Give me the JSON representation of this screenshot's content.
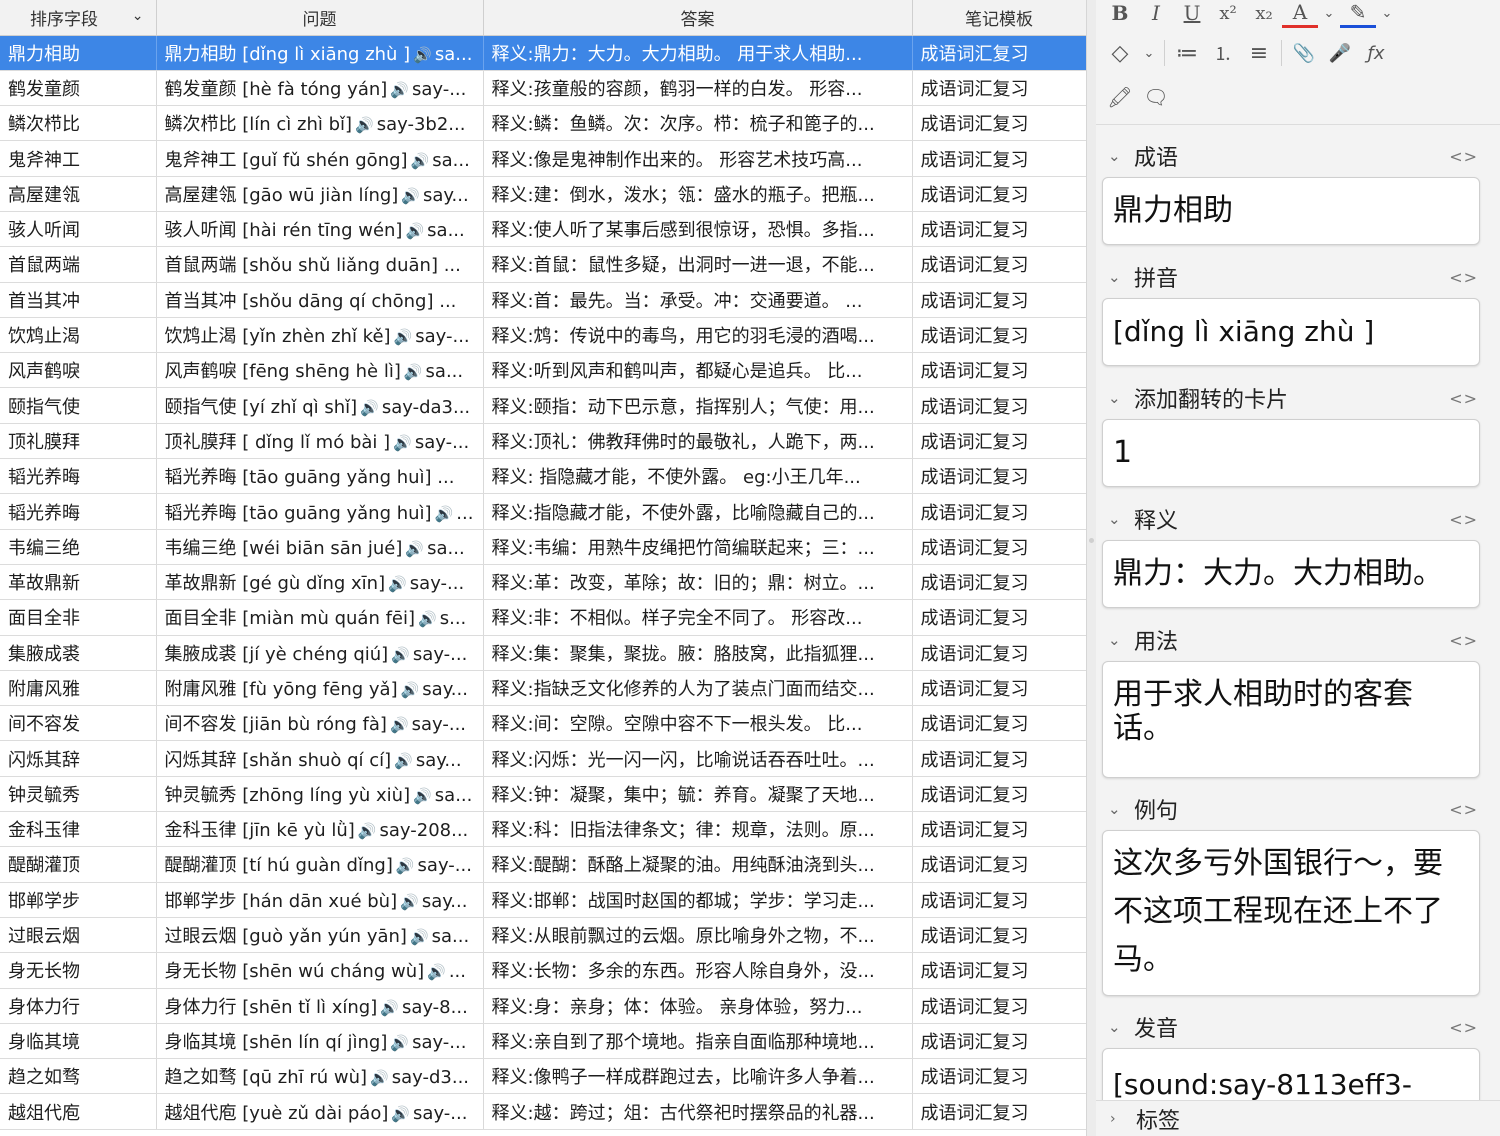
{
  "browser": {
    "columns": [
      "排序字段",
      "问题",
      "答案",
      "笔记模板"
    ],
    "selected_index": 0,
    "rows": [
      {
        "sort": "鼎力相助",
        "q": "鼎力相助 [dǐng lì xiāng zhù ]",
        "q_tail": "sa...",
        "a": "释义:鼎力：大力。大力相助。  用于求人相助...",
        "tpl": "成语词汇复习"
      },
      {
        "sort": "鹤发童颜",
        "q": "鹤发童颜 [hè fà tóng yán]",
        "q_tail": "say-...",
        "a": "释义:孩童般的容颜，鹤羽一样的白发。  形容...",
        "tpl": "成语词汇复习"
      },
      {
        "sort": "鳞次栉比",
        "q": "鳞次栉比 [lín cì zhì bǐ]",
        "q_tail": "say-3b2...",
        "a": "释义:鳞：鱼鳞。次：次序。栉：梳子和篦子的...",
        "tpl": "成语词汇复习"
      },
      {
        "sort": "鬼斧神工",
        "q": "鬼斧神工 [guǐ fǔ shén gōng]",
        "q_tail": "sa...",
        "a": "释义:像是鬼神制作出来的。  形容艺术技巧高...",
        "tpl": "成语词汇复习"
      },
      {
        "sort": "高屋建瓴",
        "q": "高屋建瓴 [gāo wū jiàn líng]",
        "q_tail": "say...",
        "a": "释义:建：倒水，泼水；瓴：盛水的瓶子。把瓶...",
        "tpl": "成语词汇复习"
      },
      {
        "sort": "骇人听闻",
        "q": "骇人听闻 [hài rén tīng wén]",
        "q_tail": "sa...",
        "a": "释义:使人听了某事后感到很惊讶，恐惧。多指...",
        "tpl": "成语词汇复习"
      },
      {
        "sort": "首鼠两端",
        "q": "首鼠两端 [shǒu shǔ liǎng duān] ...",
        "q_tail": "",
        "a": "释义:首鼠：鼠性多疑，出洞时一进一退，不能...",
        "tpl": "成语词汇复习"
      },
      {
        "sort": "首当其冲",
        "q": "首当其冲 [shǒu dāng qí chōng] ...",
        "q_tail": "",
        "a": "释义:首：最先。当：承受。冲：交通要道。  ...",
        "tpl": "成语词汇复习"
      },
      {
        "sort": "饮鸩止渴",
        "q": "饮鸩止渴 [yǐn zhèn zhǐ kě]",
        "q_tail": "say-...",
        "a": "释义:鸩：传说中的毒鸟，用它的羽毛浸的酒喝...",
        "tpl": "成语词汇复习"
      },
      {
        "sort": "风声鹤唳",
        "q": "风声鹤唳 [fēng shēng hè lì]",
        "q_tail": "sa...",
        "a": "释义:听到风声和鹤叫声，都疑心是追兵。  比...",
        "tpl": "成语词汇复习"
      },
      {
        "sort": "颐指气使",
        "q": "颐指气使 [yí zhǐ qì shǐ]",
        "q_tail": "say-da3...",
        "a": "释义:颐指：动下巴示意，指挥别人；气使：用...",
        "tpl": "成语词汇复习"
      },
      {
        "sort": "顶礼膜拜",
        "q": "顶礼膜拜 [ dǐng lǐ mó bài ]",
        "q_tail": "say-...",
        "a": "释义:顶礼：佛教拜佛时的最敬礼，人跪下，两...",
        "tpl": "成语词汇复习"
      },
      {
        "sort": "韬光养晦",
        "q": "韬光养晦  [tāo guāng yǎng huì] ...",
        "q_tail": "",
        "a": "释义:  指隐藏才能，不使外露。  eg:小王几年...",
        "tpl": "成语词汇复习"
      },
      {
        "sort": "韬光养晦",
        "q": "韬光养晦 [tāo guāng yǎng huì]",
        "q_tail": "...",
        "a": "释义:指隐藏才能，不使外露，比喻隐藏自己的...",
        "tpl": "成语词汇复习"
      },
      {
        "sort": "韦编三绝",
        "q": "韦编三绝 [wéi biān sān jué]",
        "q_tail": "sa...",
        "a": "释义:韦编：用熟牛皮绳把竹简编联起来；三：...",
        "tpl": "成语词汇复习"
      },
      {
        "sort": "革故鼎新",
        "q": "革故鼎新 [gé gù dǐng xīn]",
        "q_tail": "say-...",
        "a": "释义:革：改变，革除；故：旧的；鼎：树立。...",
        "tpl": "成语词汇复习"
      },
      {
        "sort": "面目全非",
        "q": "面目全非 [miàn mù quán fēi]",
        "q_tail": "s...",
        "a": "释义:非：不相似。样子完全不同了。  形容改...",
        "tpl": "成语词汇复习"
      },
      {
        "sort": "集腋成裘",
        "q": "集腋成裘 [jí yè chéng qiú]",
        "q_tail": "say-...",
        "a": "释义:集：聚集，聚拢。腋：胳肢窝，此指狐狸...",
        "tpl": "成语词汇复习"
      },
      {
        "sort": "附庸风雅",
        "q": "附庸风雅 [fù yōng fēng yǎ]",
        "q_tail": "say...",
        "a": "释义:指缺乏文化修养的人为了装点门面而结交...",
        "tpl": "成语词汇复习"
      },
      {
        "sort": "间不容发",
        "q": "间不容发 [jiān bù róng fà]",
        "q_tail": "say-...",
        "a": "释义:间：空隙。空隙中容不下一根头发。  比...",
        "tpl": "成语词汇复习"
      },
      {
        "sort": "闪烁其辞",
        "q": "闪烁其辞 [shǎn shuò qí cí]",
        "q_tail": "say...",
        "a": "释义:闪烁：光一闪一闪，比喻说话吞吞吐吐。...",
        "tpl": "成语词汇复习"
      },
      {
        "sort": "钟灵毓秀",
        "q": "钟灵毓秀 [zhōng líng yù xiù]",
        "q_tail": "sa...",
        "a": "释义:钟：凝聚，集中；毓：养育。凝聚了天地...",
        "tpl": "成语词汇复习"
      },
      {
        "sort": "金科玉律",
        "q": "金科玉律 [jīn kē yù lǜ]",
        "q_tail": "say-208...",
        "a": "释义:科：旧指法律条文；律：规章，法则。原...",
        "tpl": "成语词汇复习"
      },
      {
        "sort": "醍醐灌顶",
        "q": "醍醐灌顶 [tí hú guàn dǐng]",
        "q_tail": "say-...",
        "a": "释义:醍醐：酥酪上凝聚的油。用纯酥油浇到头...",
        "tpl": "成语词汇复习"
      },
      {
        "sort": "邯郸学步",
        "q": "邯郸学步 [hán dān xué bù]",
        "q_tail": "say...",
        "a": "释义:邯郸：战国时赵国的都城；学步：学习走...",
        "tpl": "成语词汇复习"
      },
      {
        "sort": "过眼云烟",
        "q": "过眼云烟 [guò yǎn yún yān]",
        "q_tail": "sa...",
        "a": "释义:从眼前飘过的云烟。原比喻身外之物，不...",
        "tpl": "成语词汇复习"
      },
      {
        "sort": "身无长物",
        "q": "身无长物 [shēn wú cháng wù]",
        "q_tail": "...",
        "a": "释义:长物：多余的东西。形容人除自身外，没...",
        "tpl": "成语词汇复习"
      },
      {
        "sort": "身体力行",
        "q": "身体力行 [shēn tǐ lì xíng]",
        "q_tail": "say-8...",
        "a": "释义:身：亲身；体：体验。  亲身体验，努力...",
        "tpl": "成语词汇复习"
      },
      {
        "sort": "身临其境",
        "q": "身临其境 [shēn lín qí jìng]",
        "q_tail": "say-...",
        "a": "释义:亲自到了那个境地。指亲自面临那种境地...",
        "tpl": "成语词汇复习"
      },
      {
        "sort": "趋之如骛",
        "q": "趋之如骛 [qū zhī rú wù]",
        "q_tail": "say-d3...",
        "a": "释义:像鸭子一样成群跑过去，比喻许多人争着...",
        "tpl": "成语词汇复习"
      },
      {
        "sort": "越俎代庖",
        "q": "越俎代庖 [yuè zǔ dài páo]",
        "q_tail": "say-...",
        "a": "释义:越：跨过；俎：古代祭祀时摆祭品的礼器...",
        "tpl": "成语词汇复习"
      }
    ]
  },
  "toolbar": {
    "row1": [
      "B",
      "I",
      "U",
      "x²",
      "x₂",
      "A",
      "⌄",
      "✎",
      "⌄"
    ],
    "row2": [
      "◇",
      "⌄",
      "≔",
      "⒈",
      "≡",
      "📎",
      "🎤",
      "ƒx"
    ],
    "row3": [
      "🖍",
      "🗨"
    ]
  },
  "editor": {
    "fields": [
      {
        "name": "成语",
        "value": "鼎力相助"
      },
      {
        "name": "拼音",
        "value": "[dǐng lì xiāng zhù ]"
      },
      {
        "name": "添加翻转的卡片",
        "value": "1"
      },
      {
        "name": "释义",
        "value": "鼎力：大力。大力相助。"
      },
      {
        "name": "用法",
        "value": "用于求人相助时的客套话。"
      },
      {
        "name": "例句",
        "value": "这次多亏外国银行～，要不这项工程现在还上不了马。"
      },
      {
        "name": "发音",
        "value": "[sound:say-8113eff3-"
      }
    ],
    "tags_label": "标签"
  },
  "colors": {
    "selection": "#3d86e6",
    "font_color_underline": "#e0302a",
    "highlight_underline": "#1a4fd8"
  }
}
